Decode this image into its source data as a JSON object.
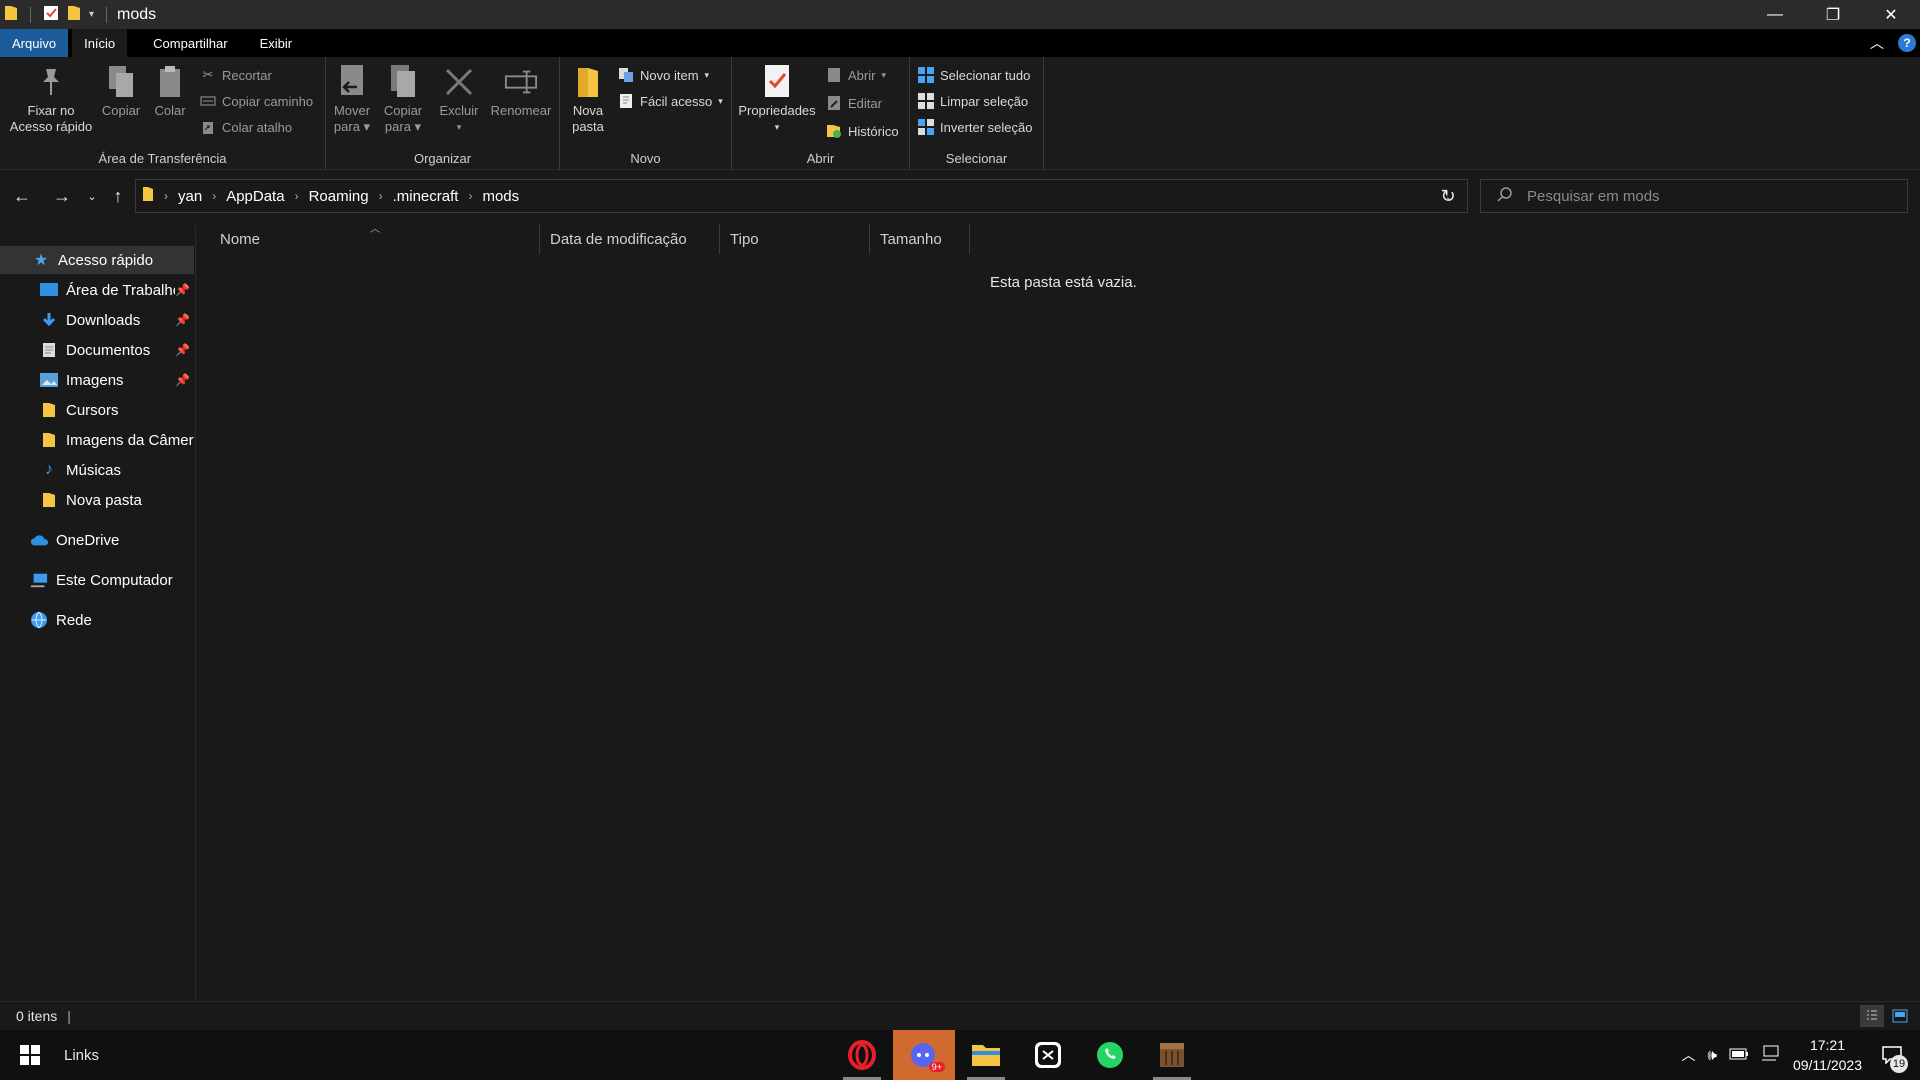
{
  "window": {
    "title": "mods"
  },
  "window_controls": {
    "minimize": "—",
    "maximize": "❐",
    "close": "✕"
  },
  "ribbon_tabs": [
    {
      "label": "Arquivo"
    },
    {
      "label": "Início"
    },
    {
      "label": "Compartilhar"
    },
    {
      "label": "Exibir"
    }
  ],
  "ribbon": {
    "clipboard": {
      "label": "Área de Transferência",
      "pin_line1": "Fixar no",
      "pin_line2": "Acesso rápido",
      "copy": "Copiar",
      "paste": "Colar",
      "cut": "Recortar",
      "copy_path": "Copiar caminho",
      "paste_shortcut": "Colar atalho"
    },
    "organize": {
      "label": "Organizar",
      "move_line1": "Mover",
      "move_line2": "para",
      "copyto_line1": "Copiar",
      "copyto_line2": "para",
      "delete": "Excluir",
      "rename": "Renomear"
    },
    "new": {
      "label": "Novo",
      "new_folder_line1": "Nova",
      "new_folder_line2": "pasta",
      "new_item": "Novo item",
      "easy_access": "Fácil acesso"
    },
    "open": {
      "label": "Abrir",
      "properties": "Propriedades",
      "open": "Abrir",
      "edit": "Editar",
      "history": "Histórico"
    },
    "select": {
      "label": "Selecionar",
      "select_all": "Selecionar tudo",
      "select_none": "Limpar seleção",
      "invert": "Inverter seleção"
    }
  },
  "address": {
    "breadcrumb": [
      "yan",
      "AppData",
      "Roaming",
      ".minecraft",
      "mods"
    ],
    "search_placeholder": "Pesquisar em mods"
  },
  "nav": {
    "quick_access": "Acesso rápido",
    "pinned": [
      {
        "label": "Área de Trabalho"
      },
      {
        "label": "Downloads"
      },
      {
        "label": "Documentos"
      },
      {
        "label": "Imagens"
      }
    ],
    "recent": [
      {
        "label": "Cursors"
      },
      {
        "label": "Imagens da Câmera"
      },
      {
        "label": "Músicas"
      },
      {
        "label": "Nova pasta"
      }
    ],
    "onedrive": "OneDrive",
    "this_pc": "Este Computador",
    "network": "Rede"
  },
  "columns": {
    "name": "Nome",
    "modified": "Data de modificação",
    "type": "Tipo",
    "size": "Tamanho"
  },
  "content": {
    "empty_message": "Esta pasta está vazia."
  },
  "status": {
    "item_count": "0 itens"
  },
  "taskbar": {
    "links": "Links",
    "time": "17:21",
    "date": "09/11/2023",
    "notification_count": "19",
    "discord_badge": "9+"
  },
  "colors": {
    "accent": "#1c5b9a",
    "folder": "#f6c443",
    "taskbar_active": "#d06a2e"
  }
}
